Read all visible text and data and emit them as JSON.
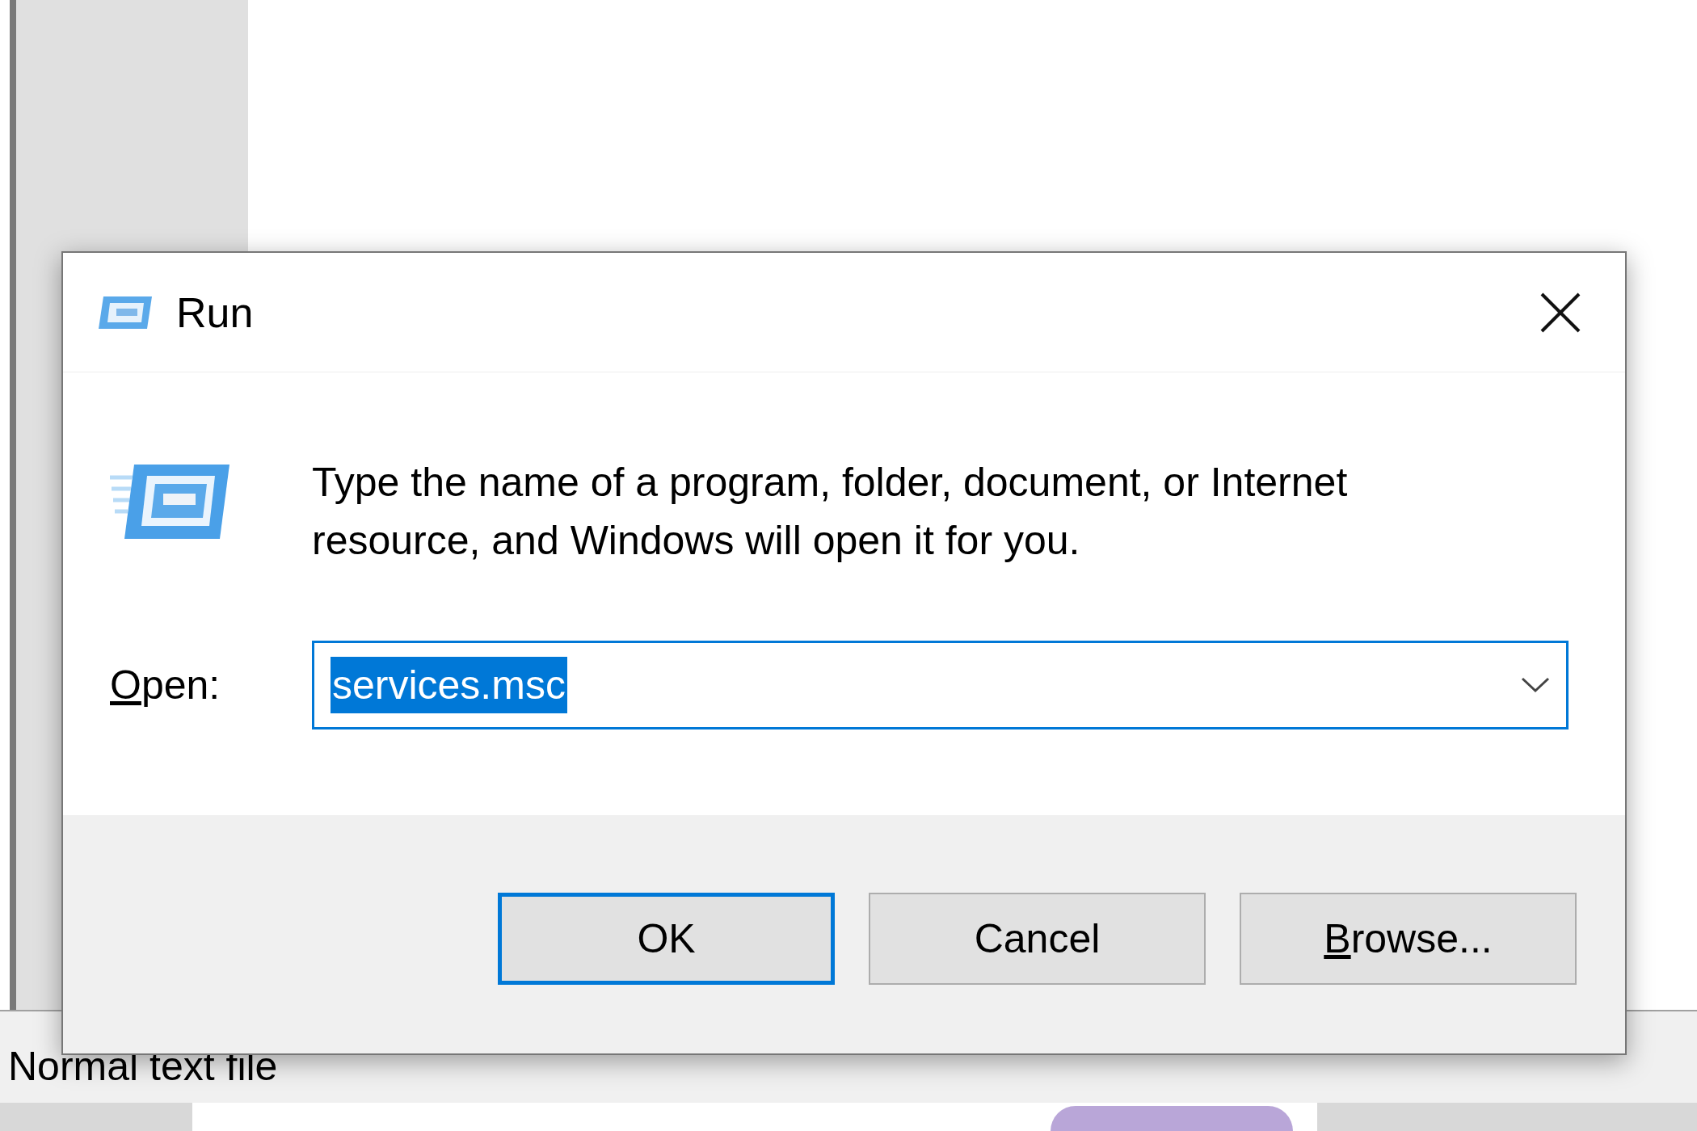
{
  "status_bar": {
    "text": "Normal text file"
  },
  "dialog": {
    "title": "Run",
    "description": "Type the name of a program, folder, document, or Internet resource, and Windows will open it for you.",
    "open_field": {
      "access_key_letter": "O",
      "label_rest": "pen:",
      "value": "services.msc",
      "text_selected": true
    },
    "buttons": [
      {
        "label": "OK",
        "focused": true
      },
      {
        "label": "Cancel",
        "focused": false
      },
      {
        "access_key_letter": "B",
        "label_rest": "rowse...",
        "focused": false
      }
    ]
  }
}
